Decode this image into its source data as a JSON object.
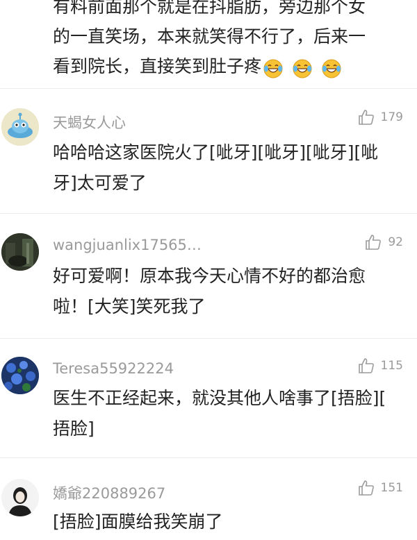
{
  "top_comment": {
    "lines": [
      "有料前面那个就是在抖脂肪，旁边那个女",
      "的一直笑场，本来就笑得不行了，后来一",
      "看到院长，直接笑到肚子疼"
    ],
    "emoji_icons": [
      "laughing-tears-emoji",
      "laughing-tears-emoji",
      "laughing-tears-emoji"
    ]
  },
  "comments": [
    {
      "username": "天蝎女人心",
      "likes": "179",
      "avatar_icon": "cartoon-alien-avatar",
      "lines": [
        "哈哈哈这家医院火了[呲牙][呲牙][呲牙][呲",
        "牙]太可爱了"
      ]
    },
    {
      "username": "wangjuanlix17565…",
      "likes": "92",
      "avatar_icon": "dark-photo-avatar",
      "lines": [
        "好可爱啊！原本我今天心情不好的都治愈",
        "啦！[大笑]笑死我了"
      ]
    },
    {
      "username": "Teresa55922224",
      "likes": "115",
      "avatar_icon": "blue-flowers-avatar",
      "lines": [
        "医生不正经起来，就没其他人啥事了[捂脸][",
        "捂脸]"
      ]
    },
    {
      "username": "嬌爺220889267",
      "likes": "151",
      "avatar_icon": "portrait-sketch-avatar",
      "lines": [
        "[捂脸]面膜给我笑崩了"
      ]
    }
  ],
  "like_icon": "thumbs-up-icon"
}
